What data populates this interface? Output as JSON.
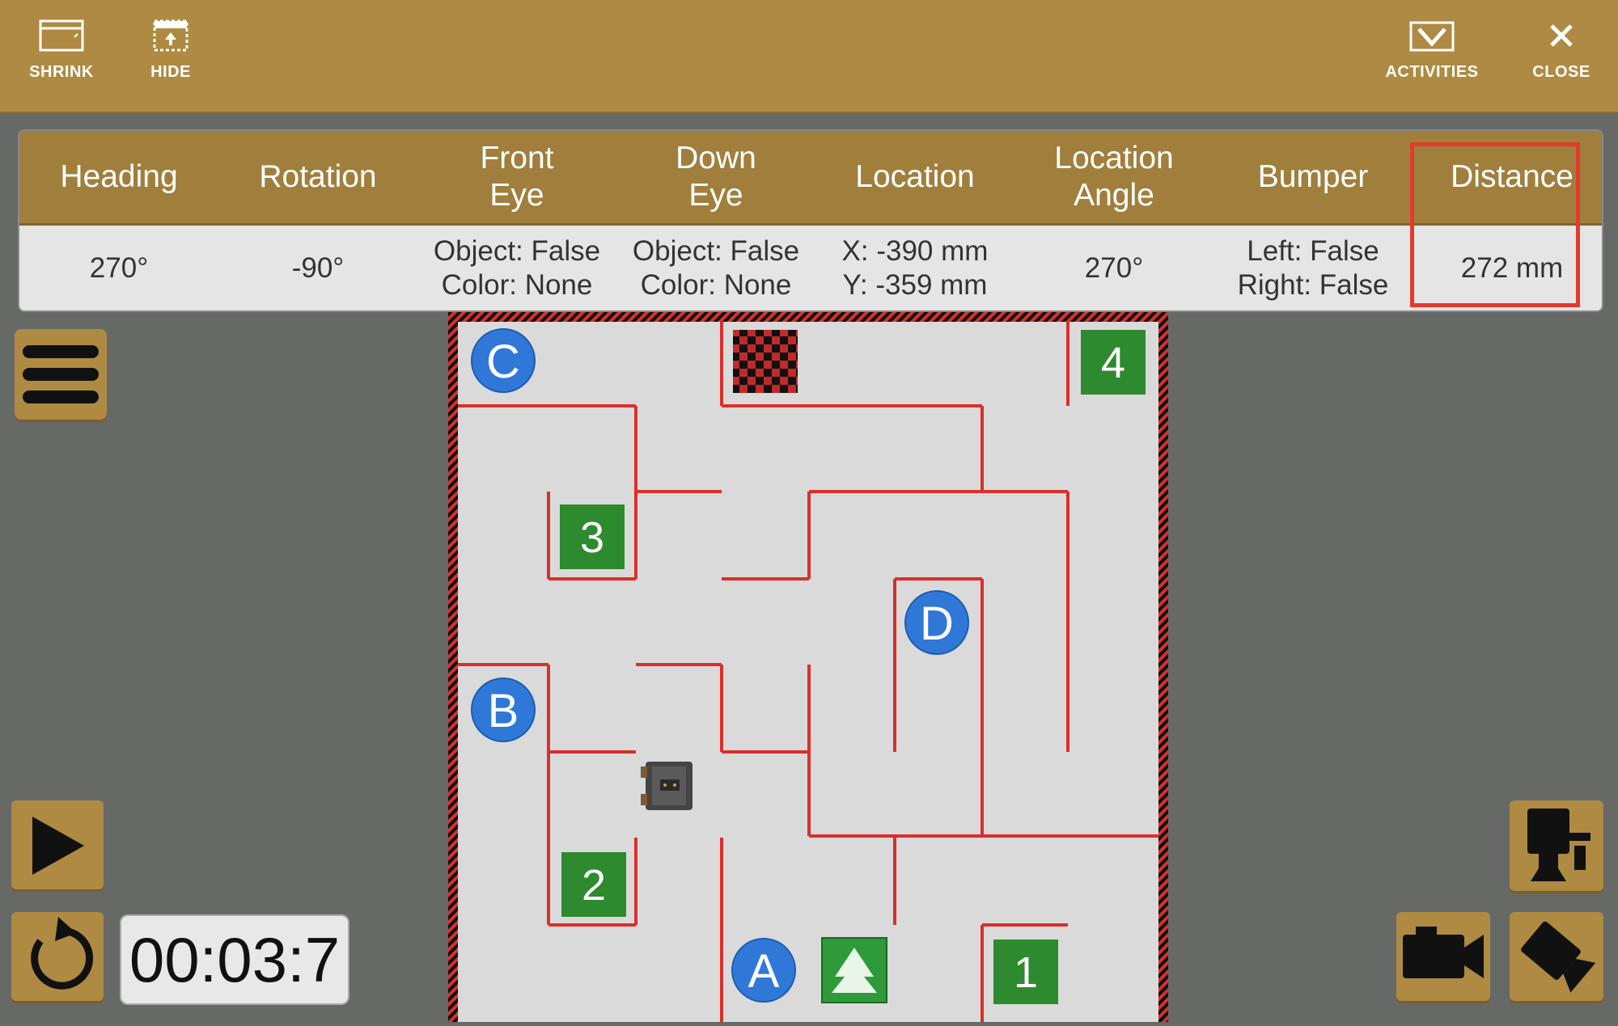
{
  "toolbar": {
    "shrink": "SHRINK",
    "hide": "HIDE",
    "activities": "ACTIVITIES",
    "close": "CLOSE"
  },
  "sensors": {
    "headers": [
      "Heading",
      "Rotation",
      "Front\nEye",
      "Down\nEye",
      "Location",
      "Location\nAngle",
      "Bumper",
      "Distance"
    ],
    "heading": "270°",
    "rotation": "-90°",
    "front_eye": [
      "Object: False",
      "Color: None"
    ],
    "down_eye": [
      "Object: False",
      "Color: None"
    ],
    "location": [
      "X: -390 mm",
      "Y: -359 mm"
    ],
    "location_angle": "270°",
    "bumper": [
      "Left: False",
      "Right: False"
    ],
    "distance": "272 mm"
  },
  "timer": "00:03:7",
  "maze": {
    "circle_labels": [
      "C",
      "B",
      "D",
      "A"
    ],
    "square_labels": [
      "4",
      "3",
      "2",
      "1"
    ]
  },
  "colors": {
    "toolbar": "#ae8a42",
    "wall": "#d9302c",
    "floor": "#dadada",
    "marker_green": "#2e8a2e",
    "marker_blue": "#2f78d8",
    "highlight": "#e23b2c"
  },
  "icons": [
    "shrink-icon",
    "hide-icon",
    "activities-icon",
    "close-icon",
    "hamburger-menu-icon",
    "play-icon",
    "reset-icon",
    "camera-icons",
    "tree-icon",
    "checker-flag-icon",
    "robot-icon"
  ]
}
